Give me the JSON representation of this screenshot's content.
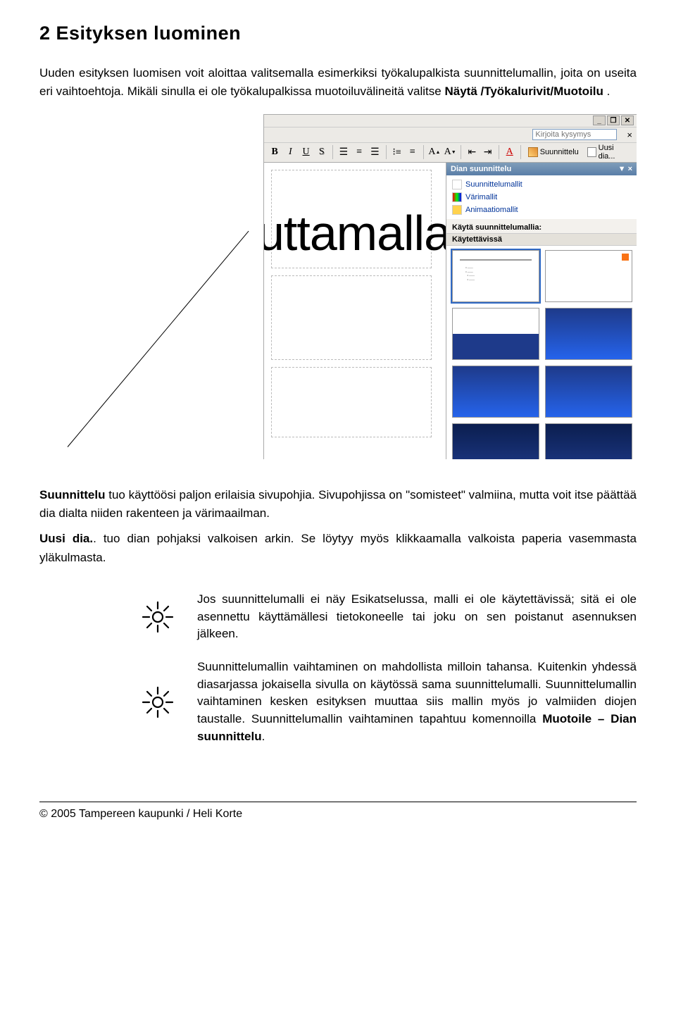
{
  "heading": "2 Esityksen luominen",
  "p1": {
    "pre": "Uuden esityksen luomisen voit aloittaa valitsemalla esimerkiksi työkalupalkista suunnittelumallin, joita on useita eri vaihtoehtoja. Mikäli sinulla ei ole työkalupalkissa muotoiluvälineitä valitse ",
    "b": "Näytä /Työkalurivit/Muotoilu",
    "post": "."
  },
  "p2": {
    "b1": "Suunnittelu",
    "post1": " tuo käyttöösi paljon erilaisia sivupohjia. Sivupohjissa on \"somisteet\" valmiina, mutta voit itse päättää dia dialta niiden rakenteen ja värimaailman."
  },
  "p3": {
    "b1": "Uusi dia.",
    "post1": ". tuo dian pohjaksi valkoisen arkin. Se löytyy myös klikkaamalla valkoista paperia vasemmasta yläkulmasta."
  },
  "tip1": "Jos suunnittelumalli ei näy Esikatselussa, malli ei ole käytettävissä; sitä ei ole asennettu käyttämällesi tietokoneelle tai joku on sen poistanut asennuksen jälkeen.",
  "tip2": {
    "pre": "Suunnittelumallin vaihtaminen on mahdollista milloin tahansa. Kuitenkin yhdessä diasarjassa jokaisella sivulla on käytössä sama suunnittelumalli. Suunnittelumallin vaihtaminen kesken esityksen muuttaa siis mallin myös jo valmiiden diojen taustalle. Suunnittelumallin vaihtaminen tapahtuu komennoilla ",
    "b": "Muotoile – Dian suunnittelu",
    "post": "."
  },
  "screenshot": {
    "help_placeholder": "Kirjoita kysymys",
    "toolbar": {
      "bold": "B",
      "italic": "I",
      "underline": "U",
      "shadow": "S",
      "labels": {
        "design": "Suunnittelu",
        "newslide": "Uusi dia..."
      }
    },
    "taskpane": {
      "title": "Dian suunnittelu",
      "links": [
        "Suunnittelumallit",
        "Värimallit",
        "Animaatiomallit"
      ],
      "section": "Käytä suunnittelumallia:",
      "sub": "Käytettävissä"
    },
    "slide_text": "uttamalla"
  },
  "footer": "© 2005 Tampereen kaupunki / Heli Korte"
}
